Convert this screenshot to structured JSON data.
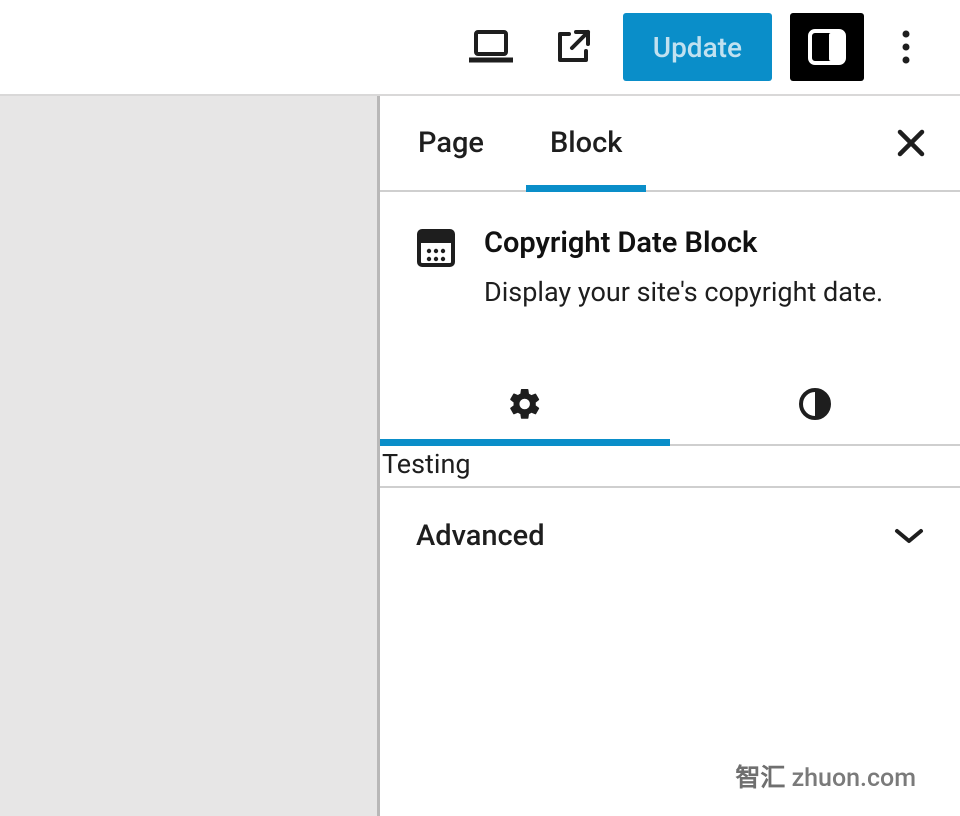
{
  "topbar": {
    "update_label": "Update"
  },
  "sidebar": {
    "tabs": [
      {
        "label": "Page"
      },
      {
        "label": "Block"
      }
    ],
    "active_tab": 1,
    "block": {
      "title": "Copyright Date Block",
      "description": "Display your site's copyright date."
    },
    "subtabs": {
      "settings_icon": "gear",
      "styles_icon": "contrast",
      "active": 0
    },
    "panels": {
      "testing_label": "Testing",
      "advanced_label": "Advanced"
    }
  },
  "watermark": {
    "zh": "智汇",
    "latin": " zhuon.com"
  }
}
